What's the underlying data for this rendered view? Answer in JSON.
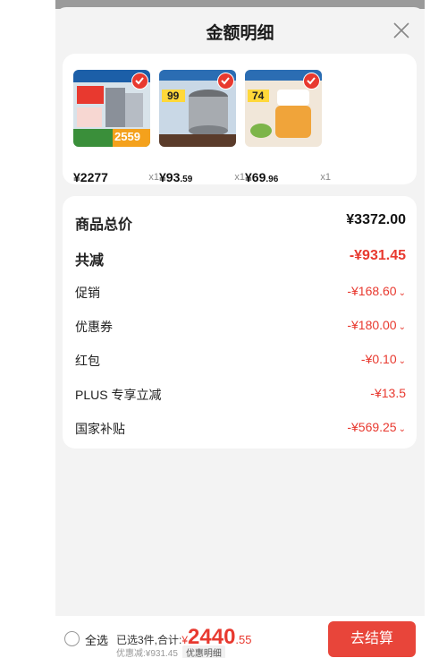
{
  "header": {
    "title": "金额明细"
  },
  "products": [
    {
      "price": "¥2277",
      "qty": "x1",
      "thumb_caption": "2559"
    },
    {
      "price_int": "¥93",
      "price_dec": ".59",
      "qty": "x1",
      "thumb_caption": "99"
    },
    {
      "price_int": "¥69",
      "price_dec": ".96",
      "qty": "x1",
      "thumb_caption": "74"
    }
  ],
  "totals": {
    "goods_total_label": "商品总价",
    "goods_total_value": "¥3372.00",
    "total_reduction_label": "共减",
    "total_reduction_value": "-¥931.45",
    "promo_label": "促销",
    "promo_value": "-¥168.60",
    "coupon_label": "优惠券",
    "coupon_value": "-¥180.00",
    "redpacket_label": "红包",
    "redpacket_value": "-¥0.10",
    "plus_label": "PLUS 专享立减",
    "plus_value": "-¥13.5",
    "subsidy_label": "国家补贴",
    "subsidy_value": "-¥569.25"
  },
  "footer": {
    "select_all": "全选",
    "selected_summary": "已选3件,合计:",
    "currency": "¥",
    "total_int": "2440",
    "total_dec": ".55",
    "discount_text": "优惠减:¥931.45",
    "detail_tag": "优惠明细",
    "checkout": "去结算"
  },
  "colors": {
    "accent": "#e8392f",
    "button": "#e8453a",
    "background": "#f3f3f3"
  }
}
